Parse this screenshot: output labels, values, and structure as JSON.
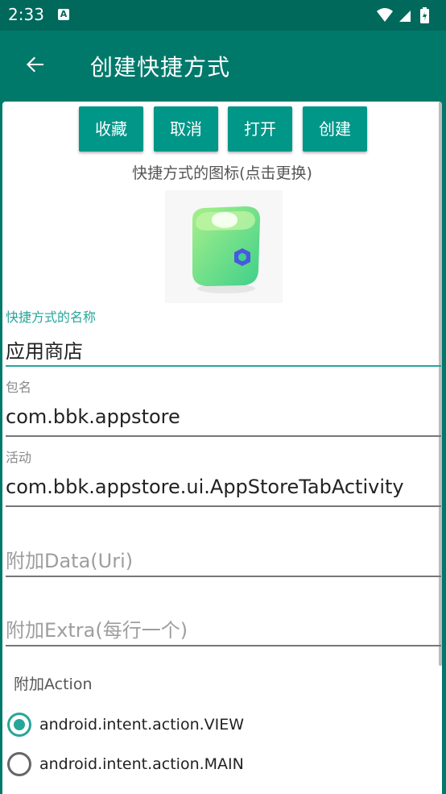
{
  "status_bar": {
    "time": "2:33",
    "notification_glyph": "A",
    "icons": [
      "wifi-icon",
      "signal-icon",
      "battery-icon"
    ]
  },
  "app_bar": {
    "title": "创建快捷方式",
    "back_icon": "arrow-back-icon"
  },
  "toolbar": {
    "favorite_label": "收藏",
    "cancel_label": "取消",
    "open_label": "打开",
    "create_label": "创建"
  },
  "icon_section": {
    "caption": "快捷方式的图标(点击更换)",
    "icon": "app-store-cube-icon"
  },
  "fields": {
    "name": {
      "label": "快捷方式的名称",
      "value": "应用商店"
    },
    "package": {
      "label": "包名",
      "value": "com.bbk.appstore"
    },
    "activity": {
      "label": "活动",
      "value": "com.bbk.appstore.ui.AppStoreTabActivity"
    },
    "data_uri": {
      "placeholder": "附加Data(Uri)"
    },
    "extra": {
      "placeholder": "附加Extra(每行一个)"
    }
  },
  "action_section": {
    "label": "附加Action",
    "options": [
      {
        "label": "android.intent.action.VIEW",
        "checked": true
      },
      {
        "label": "android.intent.action.MAIN",
        "checked": false
      }
    ]
  },
  "colors": {
    "status_bar": "#00695C",
    "app_bar": "#00796B",
    "button": "#009688",
    "accent": "#26A69A"
  }
}
